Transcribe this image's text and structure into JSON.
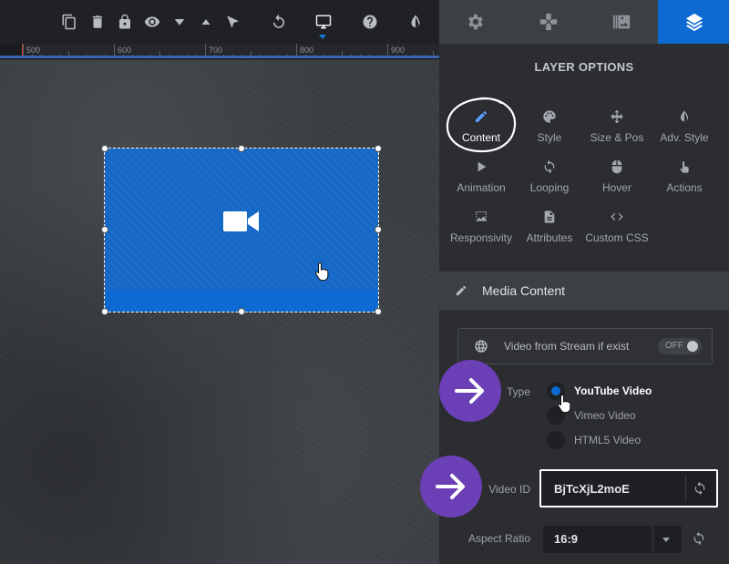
{
  "toolbar": {
    "icons": [
      "copy-icon",
      "trash-icon",
      "lock-icon",
      "eye-icon",
      "caret-down-icon",
      "caret-up-icon",
      "pointer-icon",
      "undo-icon",
      "monitor-icon",
      "help-icon",
      "contrast-icon"
    ]
  },
  "ruler": {
    "labels": [
      "500",
      "600",
      "700",
      "800",
      "900"
    ]
  },
  "sidebar_tabs": [
    "gear-icon",
    "gamepad-icon",
    "media-library-icon",
    "layers-icon"
  ],
  "layer_options": {
    "title": "LAYER OPTIONS",
    "items": [
      {
        "label": "Content",
        "icon": "pencil-icon",
        "active": true
      },
      {
        "label": "Style",
        "icon": "palette-icon"
      },
      {
        "label": "Size & Pos",
        "icon": "move-arrows-icon"
      },
      {
        "label": "Adv. Style",
        "icon": "contrast-icon"
      },
      {
        "label": "Animation",
        "icon": "play-icon"
      },
      {
        "label": "Looping",
        "icon": "loop-icon"
      },
      {
        "label": "Hover",
        "icon": "mouse-icon"
      },
      {
        "label": "Actions",
        "icon": "hand-pointer-icon"
      },
      {
        "label": "Responsivity",
        "icon": "responsive-image-icon"
      },
      {
        "label": "Attributes",
        "icon": "document-icon"
      },
      {
        "label": "Custom CSS",
        "icon": "code-icon"
      }
    ]
  },
  "media_content": {
    "title": "Media Content",
    "stream": {
      "label": "Video from Stream if exist",
      "toggle": "OFF"
    },
    "type": {
      "label": "Type",
      "options": [
        {
          "label": "YouTube Video",
          "checked": true
        },
        {
          "label": "Vimeo Video",
          "checked": false
        },
        {
          "label": "HTML5 Video",
          "checked": false
        }
      ]
    },
    "video_id": {
      "label": "Video ID",
      "value": "BjTcXjL2moE"
    },
    "aspect_ratio": {
      "label": "Aspect Ratio",
      "value": "16:9"
    }
  },
  "colors": {
    "accent": "#0c6ad2",
    "badge": "#6b3fb6",
    "panel": "#2b2d31"
  }
}
